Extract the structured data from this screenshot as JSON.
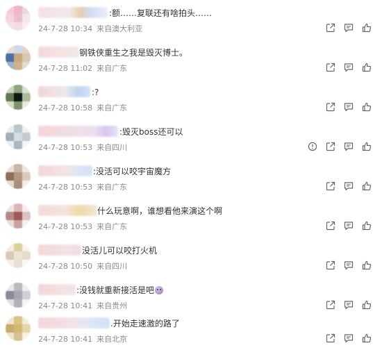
{
  "comments": [
    {
      "text": ":额……复联还有啥拍头……",
      "date": "24-7-28 10:34",
      "location": "来自澳大利亚",
      "has_report": false,
      "has_emoji": false
    },
    {
      "text": "钢铁侠重生之我是毁灭博士。",
      "date": "24-7-28 11:02",
      "location": "来自广东",
      "has_report": false,
      "has_emoji": false
    },
    {
      "text": ":?",
      "date": "24-7-28 10:58",
      "location": "来自广东",
      "has_report": false,
      "has_emoji": false
    },
    {
      "text": ":毁灭boss还可以",
      "date": "24-7-28 10:53",
      "location": "来自四川",
      "has_report": true,
      "has_emoji": false
    },
    {
      "text": ":没活可以咬宇宙魔方",
      "date": "24-7-28 10:53",
      "location": "来自广东",
      "has_report": false,
      "has_emoji": false
    },
    {
      "text": "什么玩意啊，谁想看他来演这个啊",
      "date": "24-7-28 10:53",
      "location": "来自广东",
      "has_report": false,
      "has_emoji": false
    },
    {
      "text": "没活儿可以咬打火机",
      "date": "24-7-28 10:50",
      "location": "来自四川",
      "has_report": false,
      "has_emoji": false
    },
    {
      "text": ":没钱就重新接活是吧",
      "date": "24-7-28 10:41",
      "location": "来自贵州",
      "has_report": false,
      "has_emoji": true
    },
    {
      "text": ".开始走速激的路了",
      "date": "24-7-28 10:41",
      "location": "来自北京",
      "has_report": false,
      "has_emoji": false
    }
  ],
  "icons": {
    "share": "share-icon",
    "comment": "comment-icon",
    "like": "like-icon",
    "report": "report-icon"
  },
  "colors": {
    "text": "#333333",
    "meta": "#8a8a8a",
    "icon": "#666666"
  }
}
